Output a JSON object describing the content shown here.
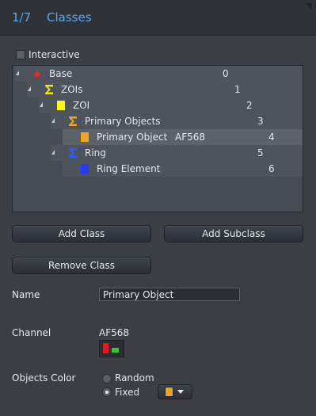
{
  "header": {
    "step": "1/7",
    "title": "Classes"
  },
  "interactive": {
    "label": "Interactive",
    "checked": false
  },
  "tree": [
    {
      "label": "Base",
      "icon": "red-arrow-icon",
      "color": "#e32b2b",
      "number": "0",
      "channel": "",
      "selected": false
    },
    {
      "label": "ZOIs",
      "icon": "sigma-icon",
      "color": "#f0e21a",
      "number": "1",
      "channel": "",
      "selected": false
    },
    {
      "label": "ZOI",
      "icon": "color-square-icon",
      "color": "#fafa00",
      "number": "2",
      "channel": "",
      "selected": false
    },
    {
      "label": "Primary Objects",
      "icon": "sigma-icon",
      "color": "#f5a31a",
      "number": "3",
      "channel": "",
      "selected": false
    },
    {
      "label": "Primary Object",
      "icon": "color-square-icon",
      "color": "#f5a31a",
      "number": "4",
      "channel": "AF568",
      "selected": true
    },
    {
      "label": "Ring",
      "icon": "sigma-icon",
      "color": "#2a5cff",
      "number": "5",
      "channel": "",
      "selected": false
    },
    {
      "label": "Ring Element",
      "icon": "color-square-icon",
      "color": "#1f3cff",
      "number": "6",
      "channel": "",
      "selected": false
    }
  ],
  "buttons": {
    "add_class": "Add Class",
    "add_subclass": "Add Subclass",
    "remove_class": "Remove Class"
  },
  "name": {
    "label": "Name",
    "value": "Primary Object"
  },
  "channel": {
    "label": "Channel",
    "value": "AF568",
    "colors": [
      "#e31b1b",
      "#1fd31f"
    ]
  },
  "objects_color": {
    "label": "Objects Color",
    "options": [
      "Random",
      "Fixed"
    ],
    "selected": "Fixed",
    "fixed_color": "#f5a31a"
  }
}
